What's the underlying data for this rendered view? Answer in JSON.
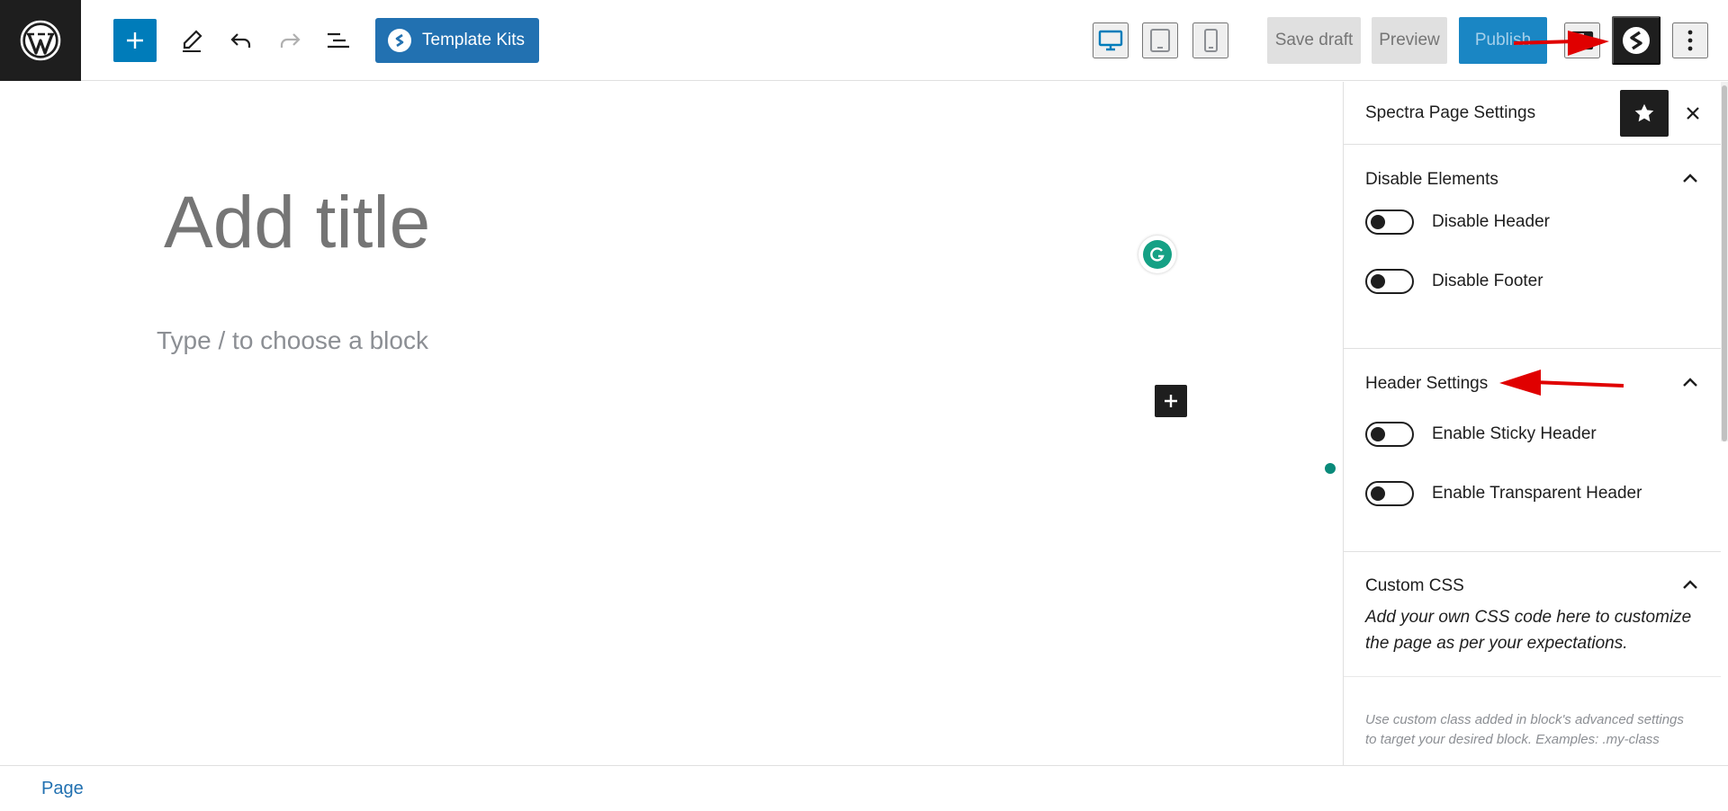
{
  "toolbar": {
    "template_kits_label": "Template Kits",
    "save_draft_label": "Save draft",
    "preview_label": "Preview",
    "publish_label": "Publish"
  },
  "editor": {
    "title_placeholder": "Add title",
    "block_placeholder": "Type / to choose a block"
  },
  "sidebar": {
    "title": "Spectra Page Settings",
    "panels": [
      {
        "title": "Disable Elements",
        "toggles": [
          {
            "label": "Disable Header",
            "checked": false
          },
          {
            "label": "Disable Footer",
            "checked": false
          }
        ]
      },
      {
        "title": "Header Settings",
        "toggles": [
          {
            "label": "Enable Sticky Header",
            "checked": false
          },
          {
            "label": "Enable Transparent Header",
            "checked": false
          }
        ]
      },
      {
        "title": "Custom CSS",
        "description": "Add your own CSS code here to customize the page as per your expectations.",
        "note": "Use custom class added in block's advanced settings to target your desired block. Examples: .my-class"
      }
    ]
  },
  "footer": {
    "breadcrumb": "Page"
  },
  "colors": {
    "accent": "#007cba",
    "template_kits": "#2271b1",
    "annotation_arrow": "#e00000"
  }
}
